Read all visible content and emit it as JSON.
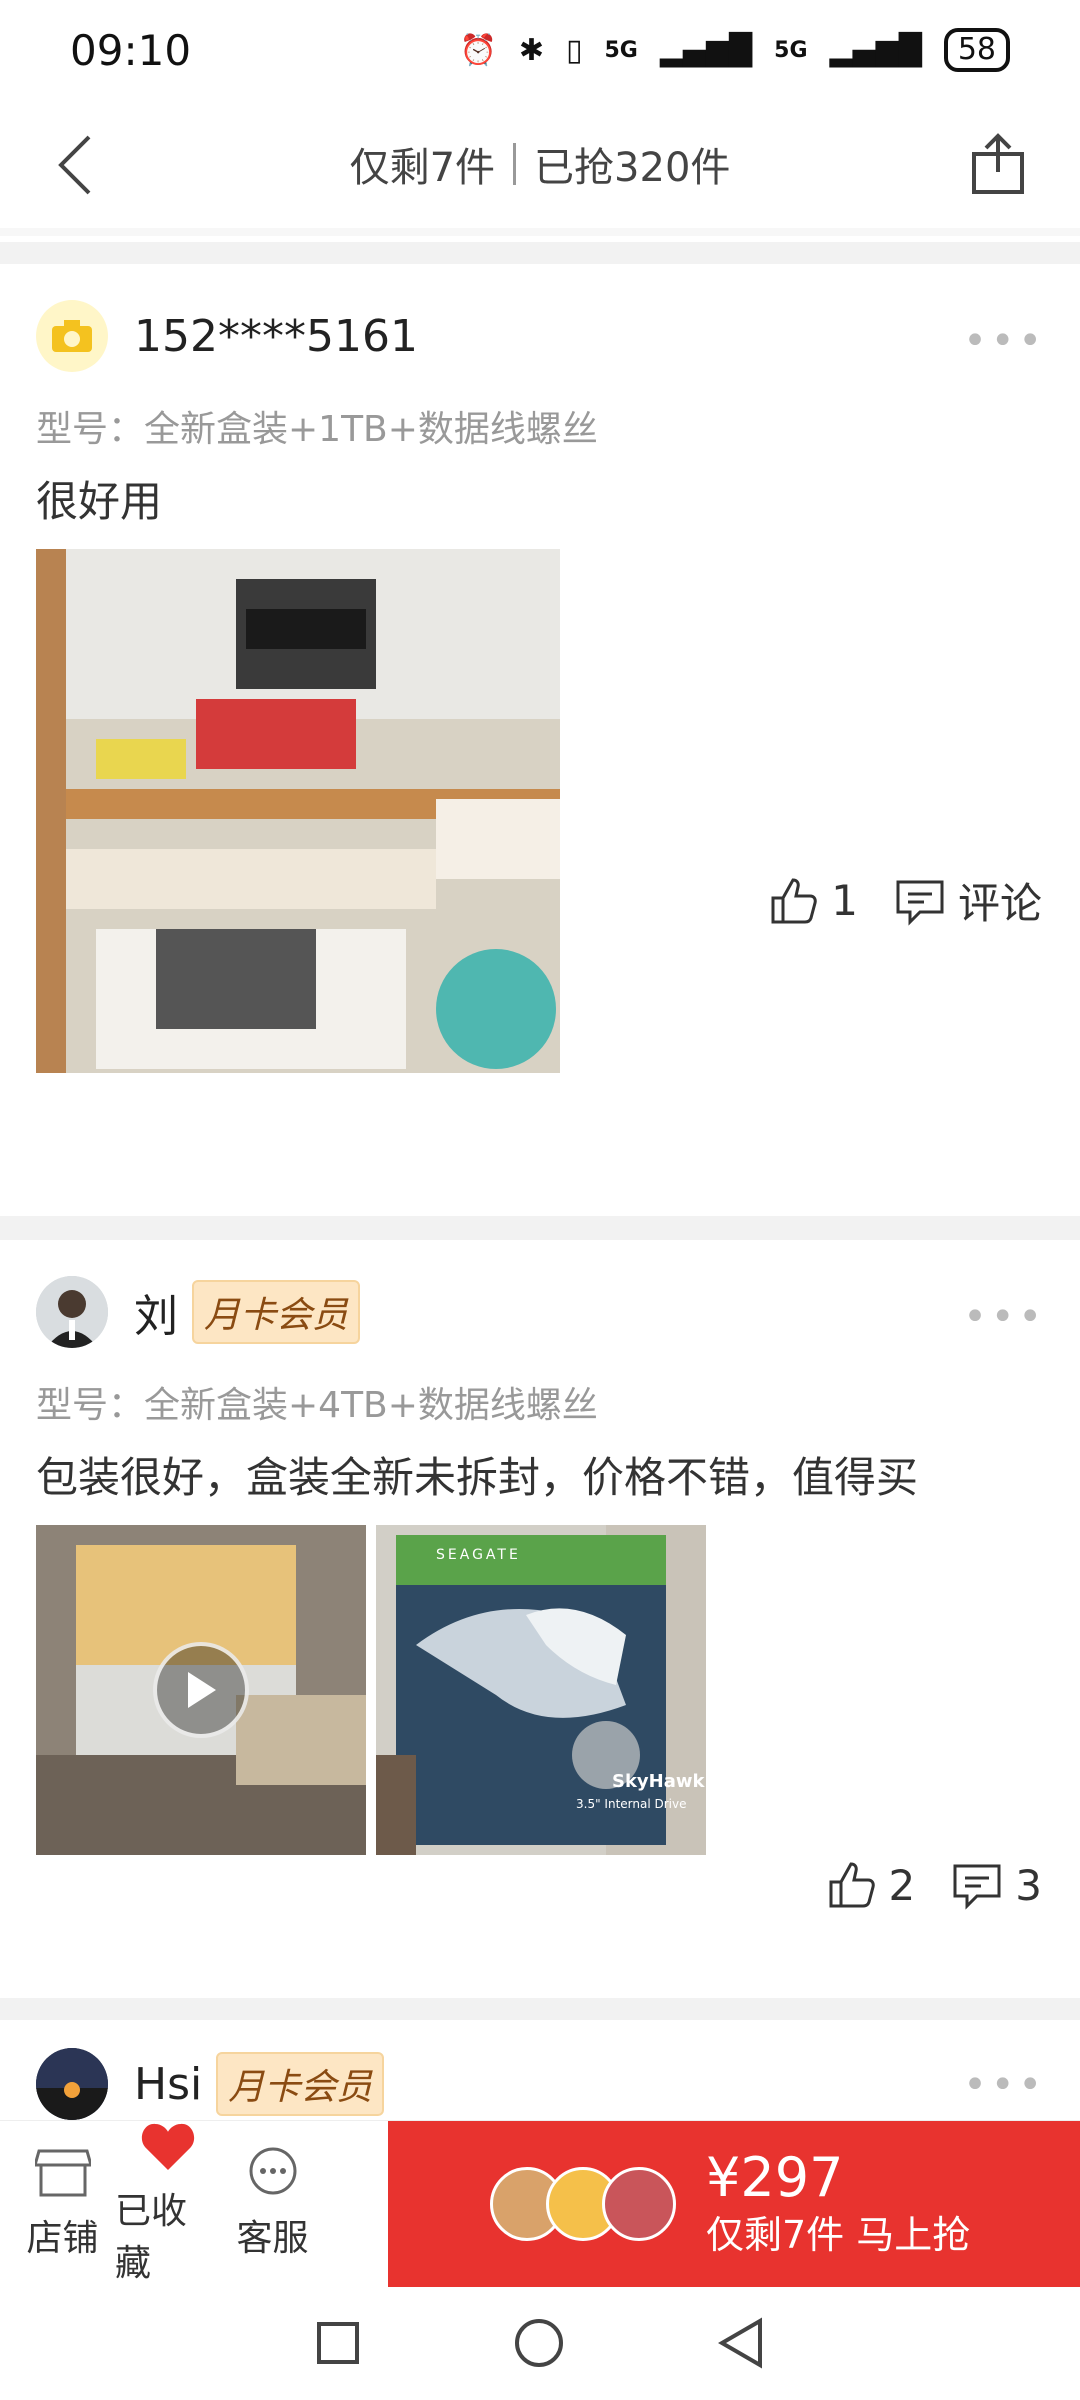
{
  "status_bar": {
    "time": "09:10",
    "net1": "5G",
    "net2": "5G",
    "battery": "58"
  },
  "header": {
    "left_text": "仅剩7件",
    "right_text": "已抢320件"
  },
  "reviews": [
    {
      "user": "152****5161",
      "badge": "",
      "model": "型号：全新盒装+1TB+数据线螺丝",
      "content": "很好用",
      "likes": "1",
      "comment_label": "评论"
    },
    {
      "user": "刘",
      "badge": "月卡会员",
      "model": "型号：全新盒装+4TB+数据线螺丝",
      "content": "包装很好，盒装全新未拆封，价格不错，值得买",
      "likes": "2",
      "comments": "3",
      "media_text": {
        "brand": "SEAGATE",
        "product": "SkyHawk",
        "spec": "3.5\" Internal Drive"
      }
    },
    {
      "user": "Hsi",
      "badge": "月卡会员"
    }
  ],
  "bottom_bar": {
    "store": "店铺",
    "favorite": "已收藏",
    "service": "客服",
    "price": "¥297",
    "cta": "仅剩7件 马上抢"
  },
  "colors": {
    "accent": "#e8332f",
    "badge_bg": "#fde6c4"
  }
}
